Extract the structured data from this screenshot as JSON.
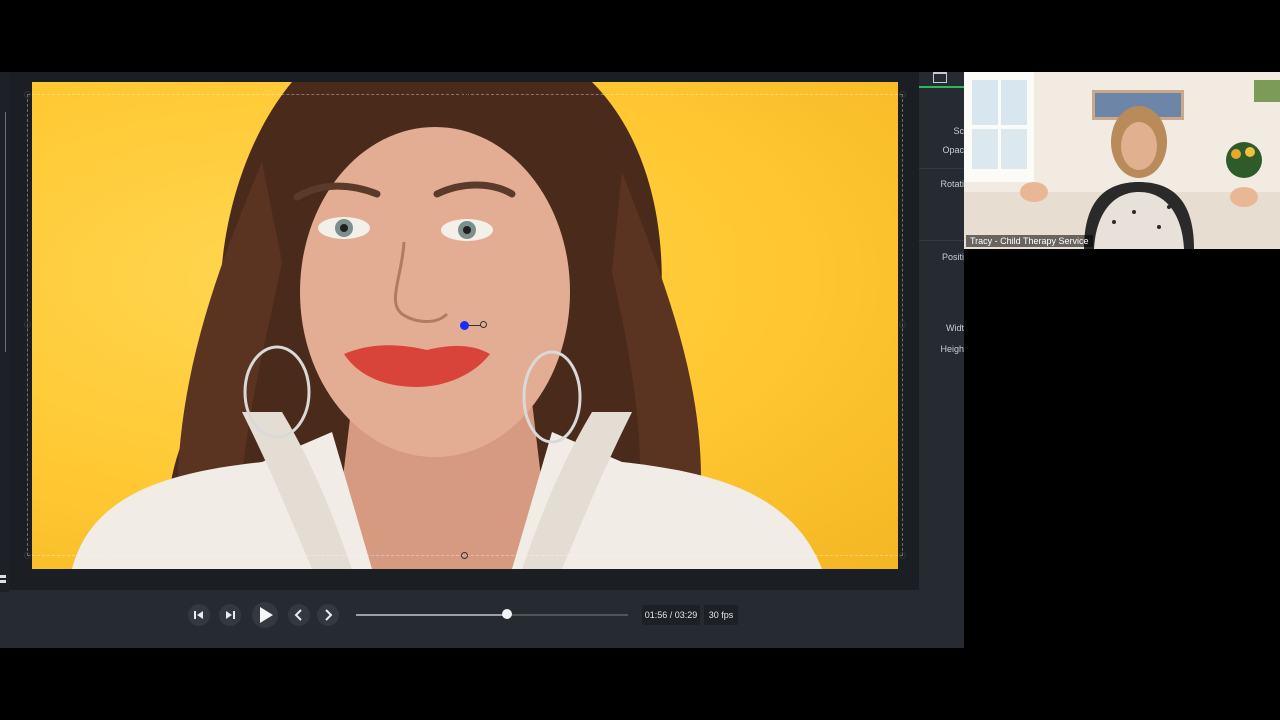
{
  "preview": {
    "subject": "woman-with-long-brown-hair-on-yellow-background",
    "background_color": "#ffc832"
  },
  "properties_panel": {
    "labels": [
      "Sc",
      "Opac",
      "Rotati",
      "Positi",
      "Widt",
      "Heigh"
    ],
    "accent_color": "#2fb85a"
  },
  "playback": {
    "time_display": "01:56 / 03:29",
    "fps_label": "30 fps",
    "progress": 0.555,
    "buttons": {
      "step_back": "step-back-icon",
      "step_forward": "step-forward-icon",
      "play": "play-icon",
      "prev": "chevron-left-icon",
      "next": "chevron-right-icon"
    }
  },
  "webcam": {
    "participant_name": "Tracy - Child Therapy Service"
  }
}
